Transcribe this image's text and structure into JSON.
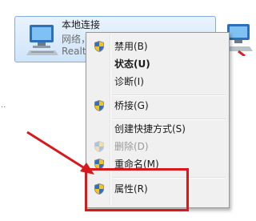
{
  "connection": {
    "name": "本地连接",
    "network": "网络，",
    "adapter": "Realte",
    "icon": "network-adapter-icon"
  },
  "second_connection": {
    "icon": "network-adapter-disconnected-icon"
  },
  "side_mark": "..",
  "context_menu": {
    "items": [
      {
        "label": "禁用(B)",
        "icon": "shield-icon",
        "bold": false,
        "disabled": false
      },
      {
        "label": "状态(U)",
        "icon": null,
        "bold": true,
        "disabled": false
      },
      {
        "label": "诊断(I)",
        "icon": null,
        "bold": false,
        "disabled": false
      },
      {
        "label": "桥接(G)",
        "icon": "shield-icon",
        "bold": false,
        "disabled": false
      },
      {
        "label": "创建快捷方式(S)",
        "icon": null,
        "bold": false,
        "disabled": false
      },
      {
        "label": "删除(D)",
        "icon": "shield-icon",
        "bold": false,
        "disabled": true
      },
      {
        "label": "重命名(M)",
        "icon": "shield-icon",
        "bold": false,
        "disabled": false
      },
      {
        "label": "属性(R)",
        "icon": "shield-icon",
        "bold": false,
        "disabled": false
      }
    ]
  },
  "annotation": {
    "color": "#d8191c",
    "target": "属性(R)"
  },
  "colors": {
    "selection": "#cfe4f9",
    "menu_bg": "#f0f0f0",
    "shield_blue": "#2f6fc6",
    "shield_yellow": "#f3c21b"
  }
}
